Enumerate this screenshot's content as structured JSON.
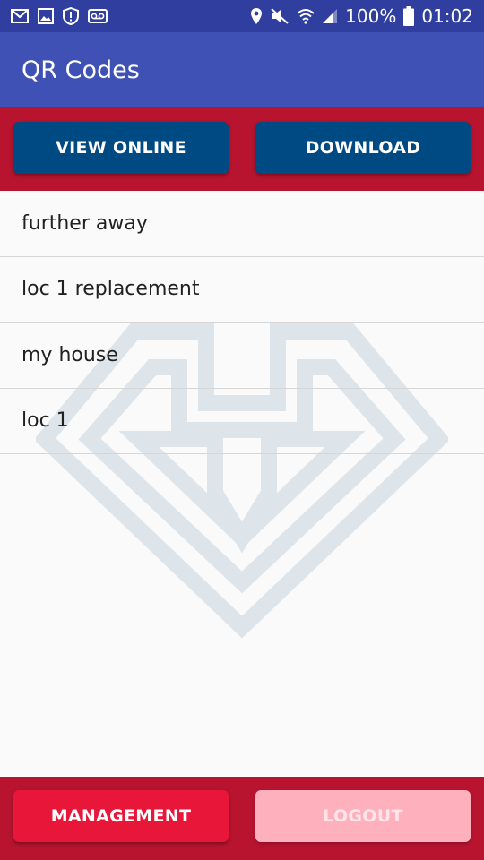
{
  "status_bar": {
    "battery": "100%",
    "time": "01:02",
    "left_icons": [
      "mail-icon",
      "image-icon",
      "shield-alert-icon",
      "voicemail-icon"
    ],
    "right_icons": [
      "location-icon",
      "mute-icon",
      "wifi-icon",
      "signal-icon",
      "battery-icon"
    ]
  },
  "app_bar": {
    "title": "QR Codes"
  },
  "top_actions": {
    "view_online": "VIEW ONLINE",
    "download": "DOWNLOAD"
  },
  "qr_list": [
    {
      "label": "further away"
    },
    {
      "label": "loc 1 replacement"
    },
    {
      "label": "my house"
    },
    {
      "label": "loc 1"
    }
  ],
  "bottom_actions": {
    "management": "MANAGEMENT",
    "logout": "LOGOUT"
  },
  "colors": {
    "status_bar": "#303f9f",
    "app_bar": "#3f51b5",
    "panel_red": "#b8142f",
    "button_blue": "#004a84",
    "button_management": "#e8173a",
    "button_logout_disabled": "#ffb0bd"
  }
}
